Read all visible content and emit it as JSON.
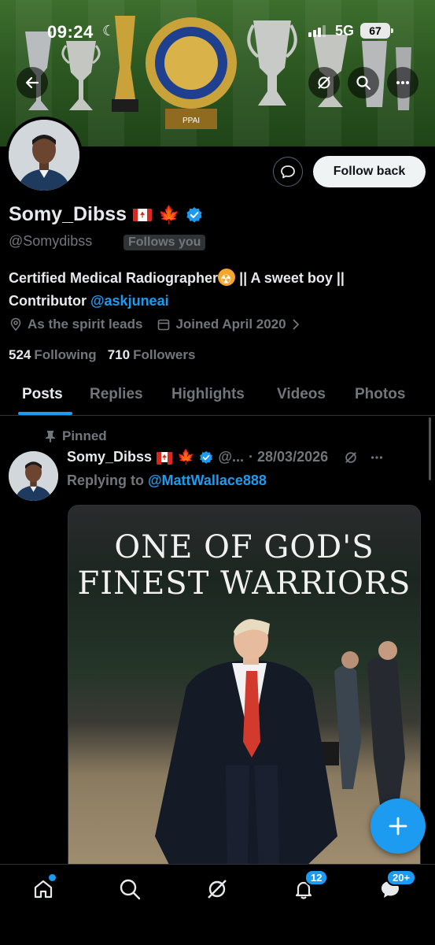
{
  "status_bar": {
    "time": "09:24",
    "network": "5G",
    "battery": "67"
  },
  "banner": {
    "trophy_label": "PPAL",
    "trophy_label_2": "PPAI"
  },
  "profile": {
    "display_name": "Somy_Dibss",
    "handle": "@Somydibss",
    "follows_you": "Follows you",
    "follow_button": "Follow back",
    "bio_text": "Certified Medical Radiographer",
    "bio_text_2": " || A sweet boy || Contributor ",
    "bio_link": "@askjuneai",
    "location": "As the spirit  leads",
    "joined": "Joined April 2020",
    "following_count": "524",
    "following_label": "Following",
    "followers_count": "710",
    "followers_label": "Followers"
  },
  "tabs": [
    "Posts",
    "Replies",
    "Highlights",
    "Videos",
    "Photos"
  ],
  "post": {
    "pinned_label": "Pinned",
    "author": "Somy_Dibss",
    "handle_truncated": "@...",
    "date": "· 28/03/2026",
    "replying_to_label": "Replying to ",
    "replying_to_handle": "@MattWallace888",
    "media_text_line1": "ONE OF GOD'S",
    "media_text_line2": "FINEST WARRIORS"
  },
  "bottom_nav": {
    "notifications_badge": "12",
    "messages_badge": "20+"
  },
  "colors": {
    "accent": "#1d9bf0",
    "background": "#000000",
    "muted": "#71767b"
  }
}
